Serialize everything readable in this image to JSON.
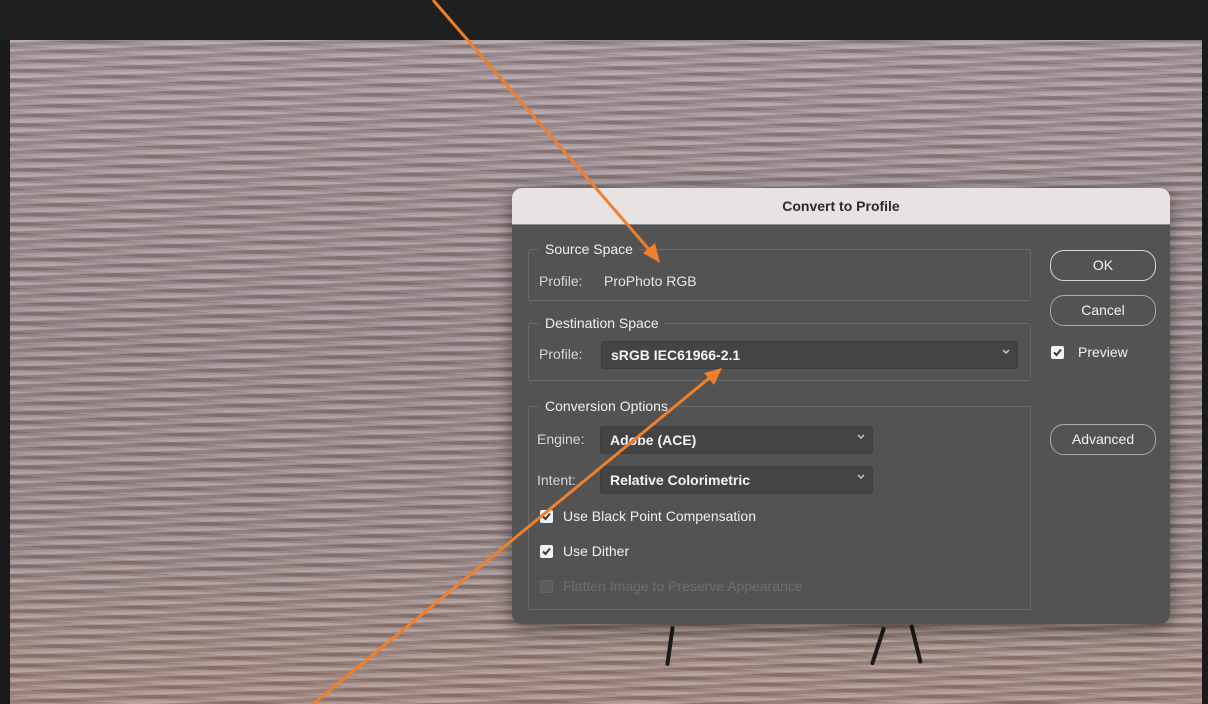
{
  "dialog": {
    "title": "Convert to Profile",
    "source_space": {
      "legend": "Source Space",
      "profile_label": "Profile:",
      "profile_value": "ProPhoto RGB"
    },
    "destination_space": {
      "legend": "Destination Space",
      "profile_label": "Profile:",
      "profile_selected": "sRGB IEC61966-2.1"
    },
    "conversion_options": {
      "legend": "Conversion Options",
      "engine_label": "Engine:",
      "engine_selected": "Adobe (ACE)",
      "intent_label": "Intent:",
      "intent_selected": "Relative Colorimetric",
      "checkboxes": [
        {
          "label": "Use Black Point Compensation",
          "checked": true,
          "enabled": true
        },
        {
          "label": "Use Dither",
          "checked": true,
          "enabled": true
        },
        {
          "label": "Flatten Image to Preserve Appearance",
          "checked": false,
          "enabled": false
        }
      ]
    },
    "buttons": {
      "ok": "OK",
      "cancel": "Cancel",
      "advanced": "Advanced"
    },
    "preview": {
      "label": "Preview",
      "checked": true
    }
  },
  "colors": {
    "annotation_arrow": "#f07f2b",
    "dialog_bg": "#535353",
    "titlebar_bg": "#e9e2e2"
  },
  "icons": {
    "dropdown": "chevron-down-icon",
    "checkbox": "checkmark-icon"
  }
}
